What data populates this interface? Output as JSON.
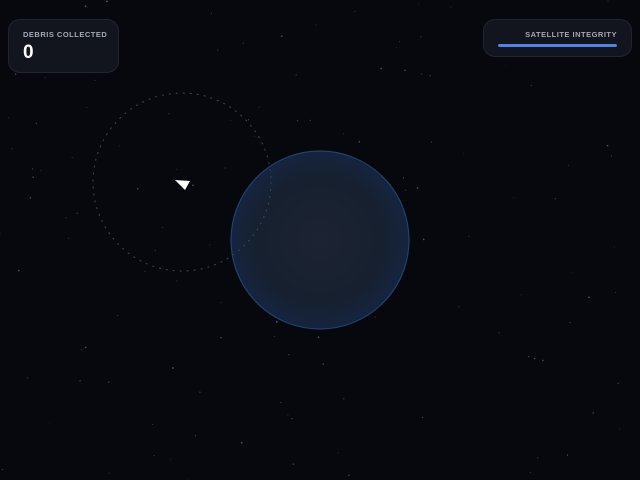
{
  "hud": {
    "score": {
      "label": "DEBRIS COLLECTED",
      "value": "0"
    },
    "integrity": {
      "label": "SATELLITE INTEGRITY",
      "level": 1.0,
      "color": "#4a86e8"
    }
  },
  "colors": {
    "space": "#06080d",
    "planet_edge": "#1d3560",
    "planet_center": "#1a2230",
    "orbit_path": "#3a4556",
    "satellite": "#ffffff"
  },
  "icons": {
    "satellite": "arrowhead-icon"
  }
}
